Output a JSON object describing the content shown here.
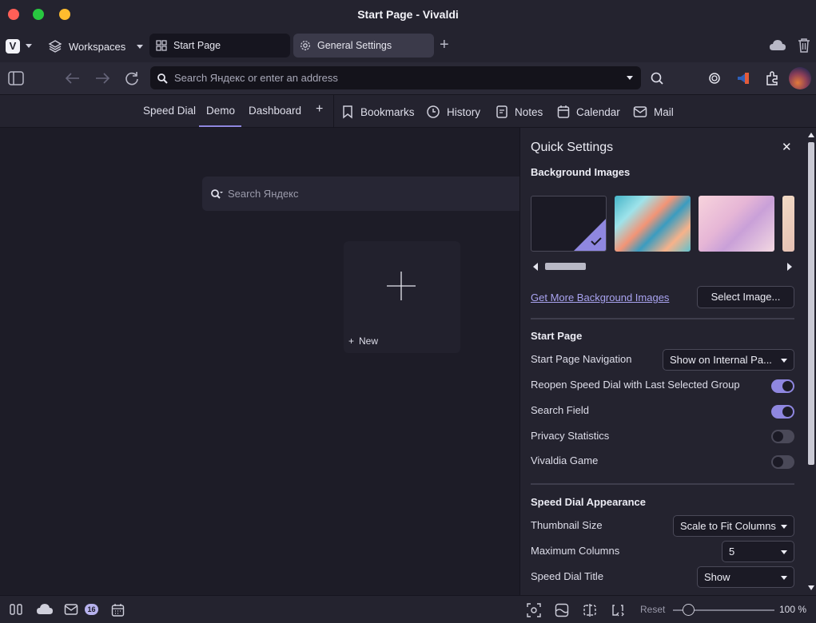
{
  "window": {
    "title": "Start Page - Vivaldi"
  },
  "tabbar": {
    "workspaces_label": "Workspaces",
    "tabs": [
      {
        "label": "Start Page"
      },
      {
        "label": "General Settings"
      }
    ]
  },
  "address": {
    "placeholder": "Search Яндекс or enter an address"
  },
  "toolbar": {
    "speed_dial_tabs": [
      {
        "label": "Speed Dial"
      },
      {
        "label": "Demo"
      },
      {
        "label": "Dashboard"
      }
    ],
    "add_label": "+",
    "items": [
      {
        "label": "Bookmarks",
        "icon": "bookmark-icon"
      },
      {
        "label": "History",
        "icon": "history-icon"
      },
      {
        "label": "Notes",
        "icon": "notes-icon"
      },
      {
        "label": "Calendar",
        "icon": "calendar-icon"
      },
      {
        "label": "Mail",
        "icon": "mail-icon"
      }
    ]
  },
  "main": {
    "search_placeholder": "Search Яндекс",
    "new_tile_label": "New"
  },
  "panel": {
    "title": "Quick Settings",
    "background_section": "Background Images",
    "get_more_link": "Get More Background Images",
    "select_image_button": "Select Image...",
    "start_page_section": "Start Page",
    "start_page_navigation_label": "Start Page Navigation",
    "start_page_navigation_value": "Show on Internal Pa...",
    "toggles": [
      {
        "label": "Reopen Speed Dial with Last Selected Group",
        "on": true
      },
      {
        "label": "Search Field",
        "on": true
      },
      {
        "label": "Privacy Statistics",
        "on": false
      },
      {
        "label": "Vivaldia Game",
        "on": false
      }
    ],
    "appearance_section": "Speed Dial Appearance",
    "thumbnail_size_label": "Thumbnail Size",
    "thumbnail_size_value": "Scale to Fit Columns",
    "max_columns_label": "Maximum Columns",
    "max_columns_value": "5",
    "speed_dial_title_label": "Speed Dial Title",
    "speed_dial_title_value": "Show"
  },
  "statusbar": {
    "mail_badge": "16",
    "reset_label": "Reset",
    "zoom": "100 %",
    "zoom_level": 0.15
  },
  "colors": {
    "accent": "#8f87e0",
    "background": "#1d1c27",
    "panel": "#24232f"
  }
}
